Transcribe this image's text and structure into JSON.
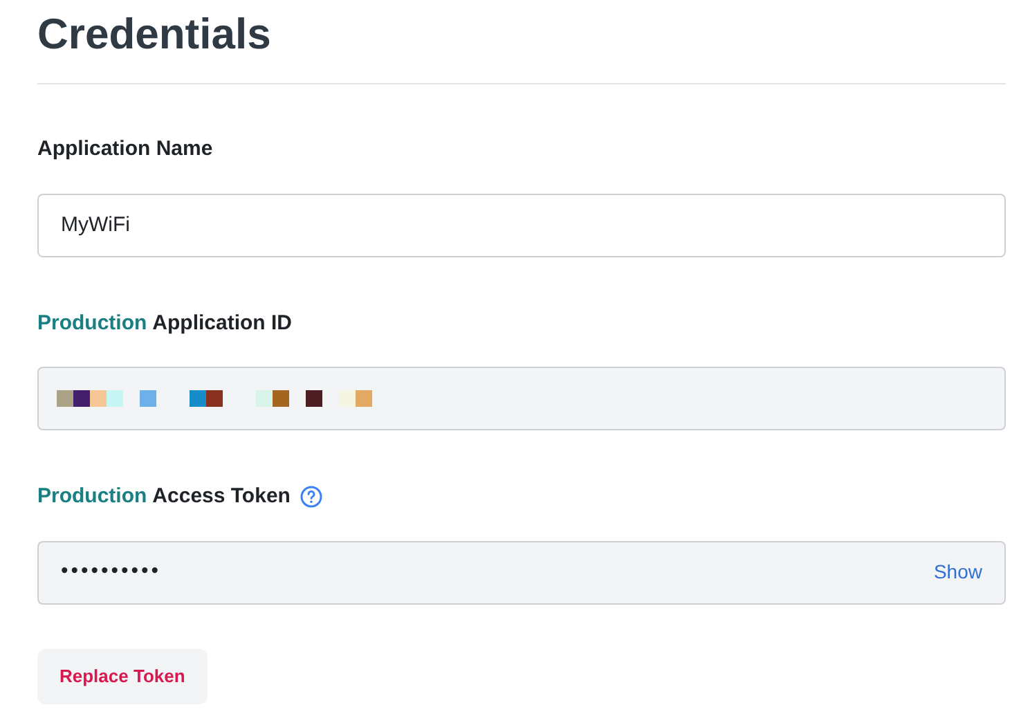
{
  "title": "Credentials",
  "fields": [
    {
      "kind": "text",
      "label": "Application Name",
      "value": "MyWiFi"
    },
    {
      "kind": "redacted",
      "env": "Production",
      "label": "Application ID"
    },
    {
      "kind": "secret",
      "env": "Production",
      "label": "Access Token",
      "help": true,
      "value": "••••••••••",
      "action": "Show"
    }
  ],
  "button": "Replace Token"
}
